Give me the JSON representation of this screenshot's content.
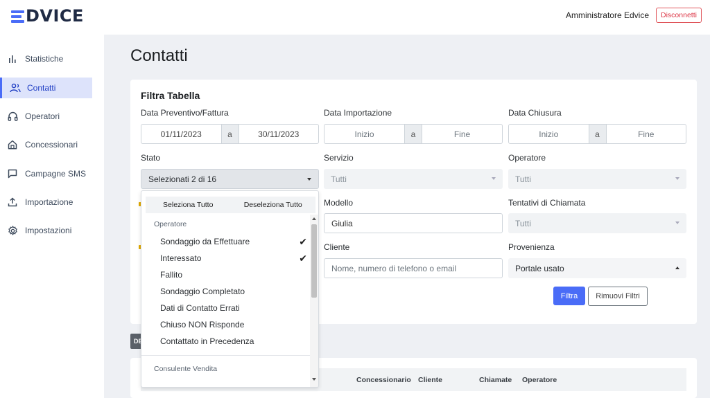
{
  "app": {
    "logo_text": "DVICE",
    "user_name": "Amministratore Edvice",
    "disconnect_label": "Disconnetti"
  },
  "sidebar": {
    "items": [
      {
        "label": "Statistiche",
        "icon": "bar-chart-icon"
      },
      {
        "label": "Contatti",
        "icon": "users-icon",
        "active": true
      },
      {
        "label": "Operatori",
        "icon": "headphones-icon"
      },
      {
        "label": "Concessionari",
        "icon": "home-icon"
      },
      {
        "label": "Campagne SMS",
        "icon": "message-square-icon"
      },
      {
        "label": "Importazione",
        "icon": "upload-icon"
      },
      {
        "label": "Impostazioni",
        "icon": "gear-icon"
      }
    ]
  },
  "page": {
    "title": "Contatti"
  },
  "filters": {
    "title": "Filtra Tabella",
    "data_preventivo": {
      "label": "Data Preventivo/Fattura",
      "from": "01/11/2023",
      "sep": "a",
      "to": "30/11/2023"
    },
    "data_importazione": {
      "label": "Data Importazione",
      "from_placeholder": "Inizio",
      "sep": "a",
      "to_placeholder": "Fine"
    },
    "data_chiusura": {
      "label": "Data Chiusura",
      "from_placeholder": "Inizio",
      "sep": "a",
      "to_placeholder": "Fine"
    },
    "stato": {
      "label": "Stato",
      "value": "Selezionati 2 di 16"
    },
    "servizio": {
      "label": "Servizio",
      "value": "Tutti"
    },
    "operatore": {
      "label": "Operatore",
      "value": "Tutti"
    },
    "modello": {
      "label": "Modello",
      "value": "Giulia"
    },
    "tentativi": {
      "label": "Tentativi di Chiamata",
      "value": "Tutti"
    },
    "cliente": {
      "label": "Cliente",
      "placeholder": "Nome, numero di telefono o email"
    },
    "provenienza": {
      "label": "Provenienza",
      "value": "Portale usato"
    },
    "filtra_label": "Filtra",
    "rimuovi_label": "Rimuovi Filtri"
  },
  "stato_dropdown": {
    "select_all": "Seleziona Tutto",
    "deselect_all": "Deseleziona Tutto",
    "group_operatore": "Operatore",
    "items": [
      {
        "label": "Sondaggio da Effettuare",
        "checked": true
      },
      {
        "label": "Interessato",
        "checked": true
      },
      {
        "label": "Fallito",
        "checked": false
      },
      {
        "label": "Sondaggio Completato",
        "checked": false
      },
      {
        "label": "Dati di Contatto Errati",
        "checked": false
      },
      {
        "label": "Chiuso NON Risponde",
        "checked": false
      },
      {
        "label": "Contattato in Precedenza",
        "checked": false
      }
    ],
    "group_consulente": "Consulente Vendita",
    "check_glyph": "✔"
  },
  "table": {
    "export_tag": "DE",
    "columns": [
      "Concessionario",
      "Cliente",
      "Chiamate",
      "Operatore"
    ]
  }
}
